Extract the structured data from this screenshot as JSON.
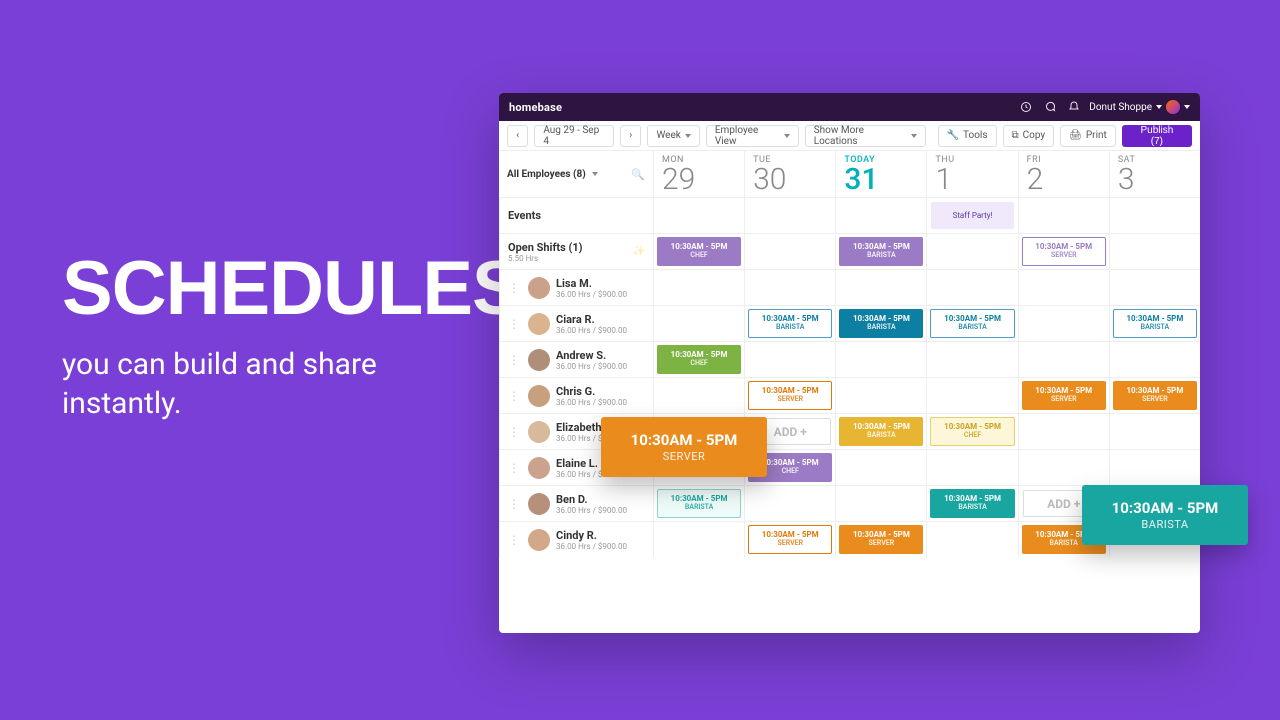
{
  "hero": {
    "title": "SCHEDULES",
    "subtitle": "you can build and share instantly."
  },
  "topbar": {
    "brand": "homebase",
    "workspace": "Donut Shoppe"
  },
  "toolbar": {
    "range": "Aug 29 - Sep 4",
    "view": "Week",
    "mode": "Employee View",
    "locations": "Show More Locations",
    "tools": "Tools",
    "copy": "Copy",
    "print": "Print",
    "publish": "Publish (7)"
  },
  "filter": {
    "label": "All Employees (8)"
  },
  "days": [
    {
      "label": "MON",
      "num": "29",
      "today": false
    },
    {
      "label": "TUE",
      "num": "30",
      "today": false
    },
    {
      "label": "TODAY",
      "num": "31",
      "today": true
    },
    {
      "label": "THU",
      "num": "1",
      "today": false
    },
    {
      "label": "FRI",
      "num": "2",
      "today": false
    },
    {
      "label": "SAT",
      "num": "3",
      "today": false
    }
  ],
  "events_label": "Events",
  "event_party": "Staff Party!",
  "openshifts": {
    "label": "Open Shifts (1)",
    "sub": "5.50 Hrs"
  },
  "roles": {
    "chef": "CHEF",
    "barista": "BARISTA",
    "server": "SERVER"
  },
  "shift_time": "10:30AM - 5PM",
  "add_label": "ADD +",
  "employees": [
    {
      "name": "Lisa M.",
      "sub": "36.00 Hrs / $900.00"
    },
    {
      "name": "Ciara R.",
      "sub": "36.00 Hrs / $900.00"
    },
    {
      "name": "Andrew S.",
      "sub": "36.00 Hrs / $900.00"
    },
    {
      "name": "Chris G.",
      "sub": "36.00 Hrs / $900.00"
    },
    {
      "name": "Elizabeth K.",
      "sub": "36.00 Hrs / $900.00"
    },
    {
      "name": "Elaine L.",
      "sub": "36.00 Hrs / $900.00"
    },
    {
      "name": "Ben D.",
      "sub": "36.00 Hrs / $900.00"
    },
    {
      "name": "Cindy R.",
      "sub": "36.00 Hrs / $900.00"
    }
  ],
  "colors": {
    "purple": "#9b7bc5",
    "tealDk": "#0d7fa3",
    "tealOutline": "#0d9bb4",
    "teal": "#1aa6a0",
    "green": "#7cb342",
    "orange": "#e98c1d",
    "orangeDk": "#e07b0a",
    "yellow": "#e7b531",
    "yellowPale": "#f7e07a",
    "mintOutline": "#8fd4c8",
    "blueOutline": "#4aa0c9",
    "serverCard": "#e98c1d",
    "baristaCard": "#1aa6a0"
  },
  "float": {
    "server": {
      "time": "10:30AM - 5PM",
      "role": "SERVER"
    },
    "barista": {
      "time": "10:30AM - 5PM",
      "role": "BARISTA"
    }
  }
}
